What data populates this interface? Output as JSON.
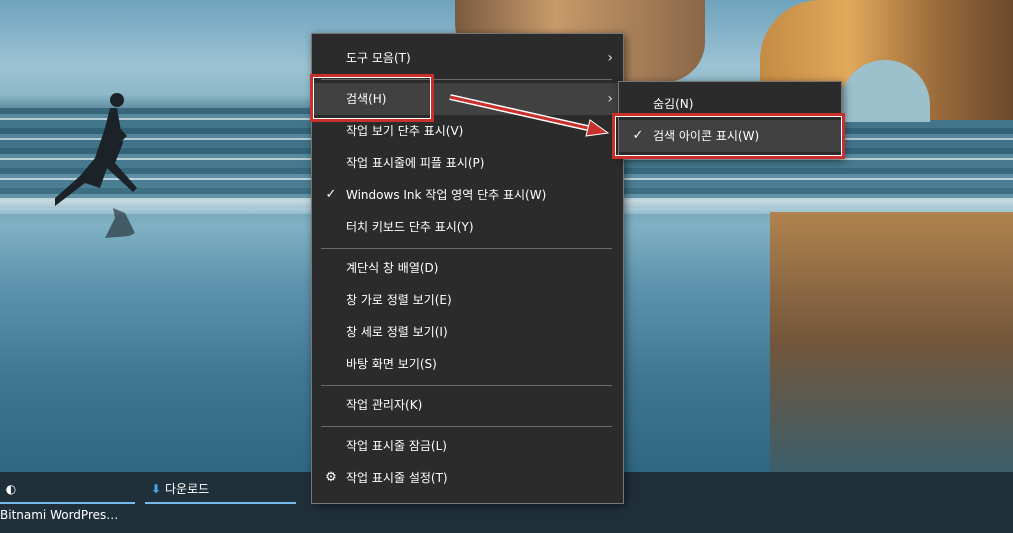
{
  "main_menu": {
    "items": [
      {
        "label": "도구 모음(T)",
        "check": "",
        "submenu": true
      },
      {
        "label": "검색(H)",
        "check": "",
        "submenu": true
      },
      {
        "label": "작업 보기 단추 표시(V)",
        "check": ""
      },
      {
        "label": "작업 표시줄에 피플 표시(P)",
        "check": ""
      },
      {
        "label": "Windows Ink 작업 영역 단추 표시(W)",
        "check": "✓"
      },
      {
        "label": "터치 키보드 단추 표시(Y)",
        "check": ""
      },
      {
        "label": "계단식 창 배열(D)",
        "check": ""
      },
      {
        "label": "창 가로 정렬 보기(E)",
        "check": ""
      },
      {
        "label": "창 세로 정렬 보기(I)",
        "check": ""
      },
      {
        "label": "바탕 화면 보기(S)",
        "check": ""
      },
      {
        "label": "작업 관리자(K)",
        "check": ""
      },
      {
        "label": "작업 표시줄 잠금(L)",
        "check": ""
      },
      {
        "label": "작업 표시줄 설정(T)",
        "check": "⚙"
      }
    ],
    "submenu_arrow": "›"
  },
  "search_submenu": {
    "items": [
      {
        "label": "숨김(N)",
        "check": ""
      },
      {
        "label": "검색 아이콘 표시(W)",
        "check": "✓"
      }
    ]
  },
  "taskbar": {
    "items": [
      {
        "label": "Bitnami WordPress S...",
        "icon": "browser-icon"
      },
      {
        "label": "다운로드",
        "icon": "download-icon"
      }
    ]
  },
  "colors": {
    "menu_bg": "#2b2b2b",
    "menu_highlight": "#414141",
    "annotation": "#c9302c",
    "taskbar_bg": "#20303a",
    "taskbar_accent": "#76b9ed"
  }
}
